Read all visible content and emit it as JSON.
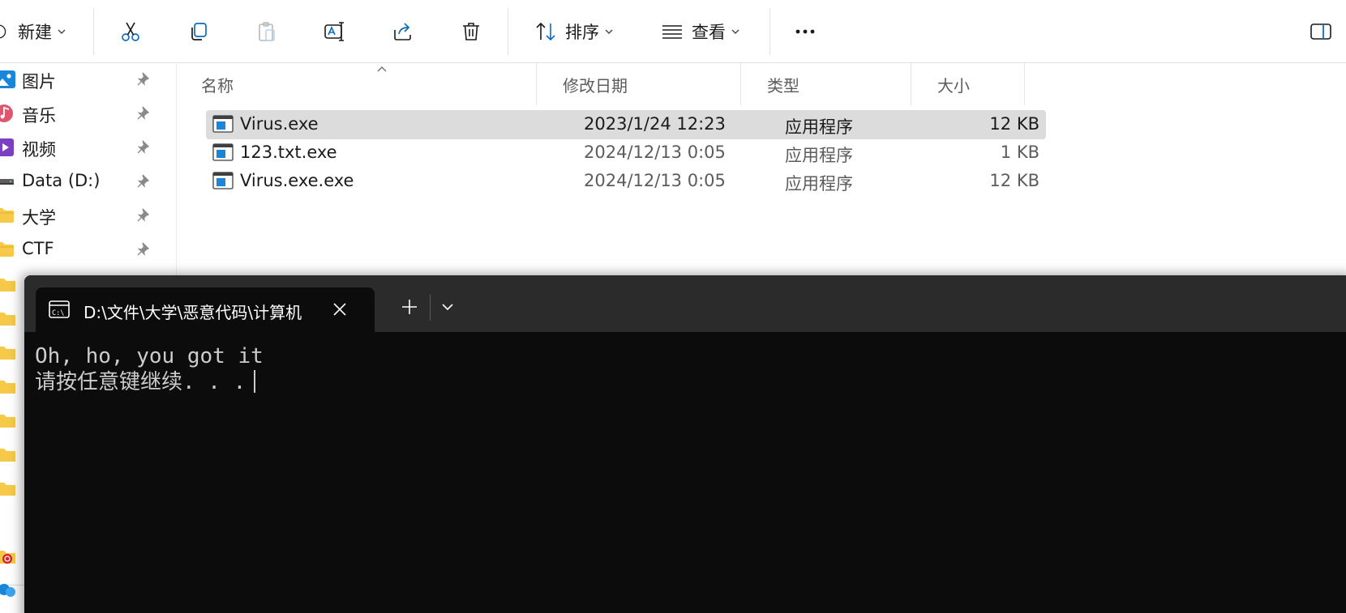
{
  "toolbar": {
    "new_label": "新建",
    "sort_label": "排序",
    "view_label": "查看",
    "more_glyph": "•••"
  },
  "nav": {
    "items": [
      {
        "label": "图片",
        "icon": "pictures-icon"
      },
      {
        "label": "音乐",
        "icon": "music-icon"
      },
      {
        "label": "视频",
        "icon": "video-icon"
      },
      {
        "label": "Data (D:)",
        "icon": "drive-icon"
      },
      {
        "label": "大学",
        "icon": "folder-icon"
      },
      {
        "label": "CTF",
        "icon": "folder-icon"
      }
    ]
  },
  "filelist": {
    "columns": {
      "name": "名称",
      "modified": "修改日期",
      "type": "类型",
      "size": "大小"
    },
    "rows": [
      {
        "name": "Virus.exe",
        "modified": "2023/1/24 12:23",
        "type": "应用程序",
        "size": "12 KB",
        "selected": true
      },
      {
        "name": "123.txt.exe",
        "modified": "2024/12/13 0:05",
        "type": "应用程序",
        "size": "1 KB",
        "selected": false
      },
      {
        "name": "Virus.exe.exe",
        "modified": "2024/12/13 0:05",
        "type": "应用程序",
        "size": "12 KB",
        "selected": false
      }
    ]
  },
  "terminal": {
    "tab_title": "D:\\文件\\大学\\恶意代码\\计算机",
    "lines": [
      "Oh, ho, you got it",
      "请按任意键继续. . ."
    ]
  },
  "colors": {
    "selection": "#dcdcdc",
    "terminal_bg": "#0c0c0c",
    "terminal_tabbar": "#2b2b2b",
    "accent": "#0f6cbd",
    "folder": "#f7c948"
  }
}
